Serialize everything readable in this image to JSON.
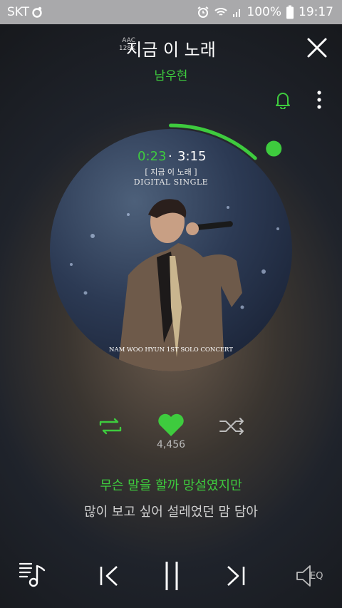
{
  "status_bar": {
    "carrier": "SKT",
    "battery": "100%",
    "time": "19:17"
  },
  "header": {
    "codec_top": "AAC",
    "codec_bottom": "128K",
    "title": "지금 이 노래",
    "artist": "남우현"
  },
  "album": {
    "elapsed": "0:23",
    "separator": "·",
    "total": "3:15",
    "subtitle": "[ 지금 이 노래 ]",
    "type_label": "DIGITAL SINGLE",
    "footer": "NAM WOO HYUN 1ST SOLO CONCERT",
    "progress_fraction": 0.118
  },
  "actions": {
    "like_count": "4,456"
  },
  "lyrics": {
    "current": "무슨 말을 할까 망설였지만",
    "next": "많이 보고 싶어 설레었던 맘 담아"
  },
  "controls": {
    "eq_label": "EQ"
  },
  "colors": {
    "accent": "#3ecb3e",
    "status_bar": "#a9a9ab"
  },
  "icons": [
    "repeat-icon",
    "heart-icon",
    "shuffle-icon",
    "playlist-icon",
    "previous-icon",
    "pause-icon",
    "next-icon",
    "eq-icon",
    "bell-icon",
    "more-icon",
    "close-icon",
    "alarm-icon",
    "wifi-icon",
    "signal-icon",
    "battery-icon"
  ]
}
